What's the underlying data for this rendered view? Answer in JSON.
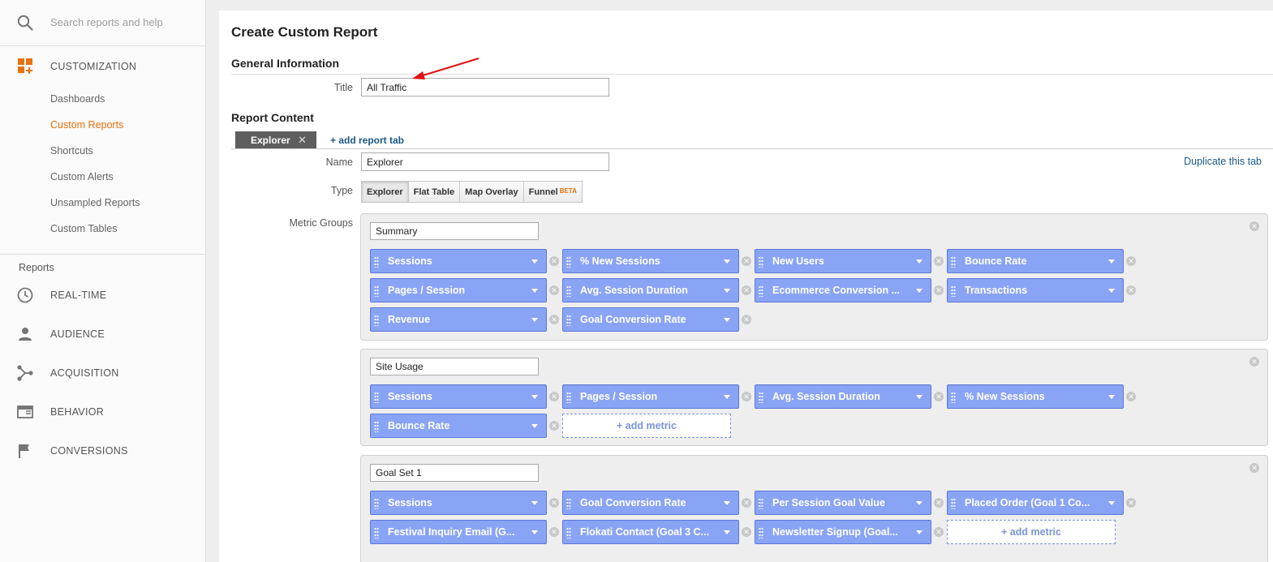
{
  "sidebar": {
    "search_placeholder": "Search reports and help",
    "customization_label": "CUSTOMIZATION",
    "customization_items": [
      "Dashboards",
      "Custom Reports",
      "Shortcuts",
      "Custom Alerts",
      "Unsampled Reports",
      "Custom Tables"
    ],
    "active_item": "Custom Reports",
    "reports_heading": "Reports",
    "nav_items": [
      "REAL-TIME",
      "AUDIENCE",
      "ACQUISITION",
      "BEHAVIOR",
      "CONVERSIONS"
    ]
  },
  "main": {
    "page_title": "Create Custom Report",
    "general_info": {
      "heading": "General Information",
      "title_label": "Title",
      "title_value": "All Traffic"
    },
    "report_content": {
      "heading": "Report Content",
      "tab_label": "Explorer",
      "tab_close": "✕",
      "add_tab_label": "+ add report tab",
      "duplicate_label": "Duplicate this tab",
      "name_label": "Name",
      "name_value": "Explorer",
      "type_label": "Type",
      "types": [
        "Explorer",
        "Flat Table",
        "Map Overlay",
        "Funnel"
      ],
      "beta_label": "BETA",
      "selected_type": "Explorer",
      "metric_groups_label": "Metric Groups",
      "groups": [
        {
          "name": "Summary",
          "metrics": [
            "Sessions",
            "% New Sessions",
            "New Users",
            "Bounce Rate",
            "Pages / Session",
            "Avg. Session Duration",
            "Ecommerce Conversion ...",
            "Transactions",
            "Revenue",
            "Goal Conversion Rate"
          ]
        },
        {
          "name": "Site Usage",
          "metrics": [
            "Sessions",
            "Pages / Session",
            "Avg. Session Duration",
            "% New Sessions",
            "Bounce Rate"
          ],
          "add_metric_label": "+ add metric"
        },
        {
          "name": "Goal Set 1",
          "metrics": [
            "Sessions",
            "Goal Conversion Rate",
            "Per Session Goal Value",
            "Placed Order (Goal 1 Co...",
            "Festival Inquiry Email (G...",
            "Flokati Contact (Goal 3 C...",
            "Newsletter Signup (Goal..."
          ],
          "add_metric_label": "+ add metric"
        }
      ]
    }
  },
  "colors": {
    "accent_orange": "#e8710a",
    "chip_blue": "#8aa4f5",
    "link_blue": "#1a5a8a",
    "arrow_red": "#e01010"
  },
  "icons": {
    "search": "search-icon",
    "customization": "dashboard-grid-icon",
    "realtime": "clock-icon",
    "audience": "person-icon",
    "acquisition": "branch-icon",
    "behavior": "window-icon",
    "conversions": "flag-icon",
    "remove": "remove-circle-icon",
    "drag": "drag-grip-icon",
    "dropdown": "caret-down-icon"
  }
}
